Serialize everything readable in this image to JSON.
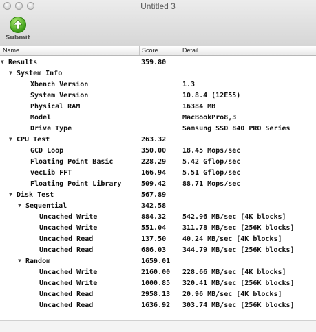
{
  "window": {
    "title": "Untitled 3"
  },
  "toolbar": {
    "submit_label": "Submit"
  },
  "columns": {
    "name": "Name",
    "score": "Score",
    "detail": "Detail"
  },
  "rows": [
    {
      "level": 0,
      "expander": true,
      "name": "Results",
      "score": "359.80",
      "detail": ""
    },
    {
      "level": 1,
      "expander": true,
      "name": "System Info",
      "score": "",
      "detail": ""
    },
    {
      "level": 2,
      "expander": false,
      "name": "Xbench Version",
      "score": "",
      "detail": "1.3"
    },
    {
      "level": 2,
      "expander": false,
      "name": "System Version",
      "score": "",
      "detail": "10.8.4 (12E55)"
    },
    {
      "level": 2,
      "expander": false,
      "name": "Physical RAM",
      "score": "",
      "detail": "16384 MB"
    },
    {
      "level": 2,
      "expander": false,
      "name": "Model",
      "score": "",
      "detail": "MacBookPro8,3"
    },
    {
      "level": 2,
      "expander": false,
      "name": "Drive Type",
      "score": "",
      "detail": "Samsung SSD 840 PRO Series"
    },
    {
      "level": 1,
      "expander": true,
      "name": "CPU Test",
      "score": "263.32",
      "detail": ""
    },
    {
      "level": 2,
      "expander": false,
      "name": "GCD Loop",
      "score": "350.00",
      "detail": "18.45 Mops/sec"
    },
    {
      "level": 2,
      "expander": false,
      "name": "Floating Point Basic",
      "score": "228.29",
      "detail": "5.42 Gflop/sec"
    },
    {
      "level": 2,
      "expander": false,
      "name": "vecLib FFT",
      "score": "166.94",
      "detail": "5.51 Gflop/sec"
    },
    {
      "level": 2,
      "expander": false,
      "name": "Floating Point Library",
      "score": "509.42",
      "detail": "88.71 Mops/sec"
    },
    {
      "level": 1,
      "expander": true,
      "name": "Disk Test",
      "score": "567.89",
      "detail": ""
    },
    {
      "level": 2,
      "expander": true,
      "name": "Sequential",
      "score": "342.58",
      "detail": ""
    },
    {
      "level": 3,
      "expander": false,
      "name": "Uncached Write",
      "score": "884.32",
      "detail": "542.96 MB/sec [4K blocks]"
    },
    {
      "level": 3,
      "expander": false,
      "name": "Uncached Write",
      "score": "551.04",
      "detail": "311.78 MB/sec [256K blocks]"
    },
    {
      "level": 3,
      "expander": false,
      "name": "Uncached Read",
      "score": "137.50",
      "detail": "40.24 MB/sec [4K blocks]"
    },
    {
      "level": 3,
      "expander": false,
      "name": "Uncached Read",
      "score": "686.03",
      "detail": "344.79 MB/sec [256K blocks]"
    },
    {
      "level": 2,
      "expander": true,
      "name": "Random",
      "score": "1659.01",
      "detail": ""
    },
    {
      "level": 3,
      "expander": false,
      "name": "Uncached Write",
      "score": "2160.00",
      "detail": "228.66 MB/sec [4K blocks]"
    },
    {
      "level": 3,
      "expander": false,
      "name": "Uncached Write",
      "score": "1000.85",
      "detail": "320.41 MB/sec [256K blocks]"
    },
    {
      "level": 3,
      "expander": false,
      "name": "Uncached Read",
      "score": "2958.13",
      "detail": "20.96 MB/sec [4K blocks]"
    },
    {
      "level": 3,
      "expander": false,
      "name": "Uncached Read",
      "score": "1636.92",
      "detail": "303.74 MB/sec [256K blocks]"
    }
  ]
}
